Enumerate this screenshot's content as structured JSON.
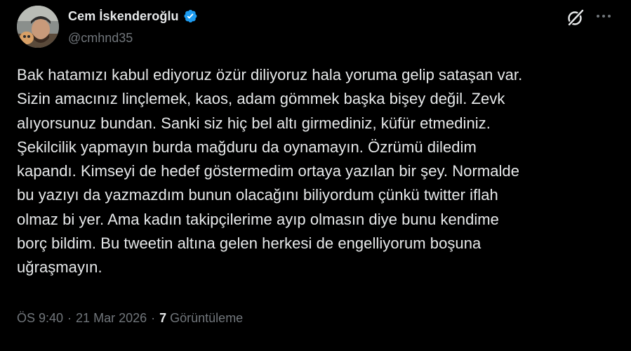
{
  "author": {
    "display_name": "Cem İskenderoğlu",
    "handle": "@cmhnd35",
    "verified": true
  },
  "icons": {
    "verified": "verified-badge-icon",
    "grok": "grok-icon",
    "more": "more-options-icon"
  },
  "colors": {
    "background": "#000000",
    "text": "#e7e9ea",
    "secondary": "#71767b",
    "verified": "#1d9bf0"
  },
  "tweet": {
    "text": "Bak hatamızı kabul ediyoruz özür diliyoruz hala yoruma gelip sataşan var.\nSizin amacınız linçlemek, kaos, adam gömmek başka bişey değil. Zevk\nalıyorsunuz bundan. Sanki siz hiç bel altı girmediniz, küfür etmediniz.\nŞekilcilik yapmayın burda mağduru da oynamayın. Özrümü diledim\nkapandı. Kimseyi de hedef göstermedim ortaya yazılan bir şey. Normalde\nbu yazıyı da yazmazdım bunun olacağını biliyordum çünkü twitter iflah\nolmaz bi yer. Ama kadın takipçilerime ayıp olmasın diye bunu kendime\nborç bildim. Bu tweetin altına gelen herkesi de engelliyorum boşuna\nuğraşmayın."
  },
  "meta": {
    "time": "ÖS 9:40",
    "separator": "·",
    "date": "21 Mar 2026",
    "views_count": "7",
    "views_label": "Görüntüleme"
  }
}
